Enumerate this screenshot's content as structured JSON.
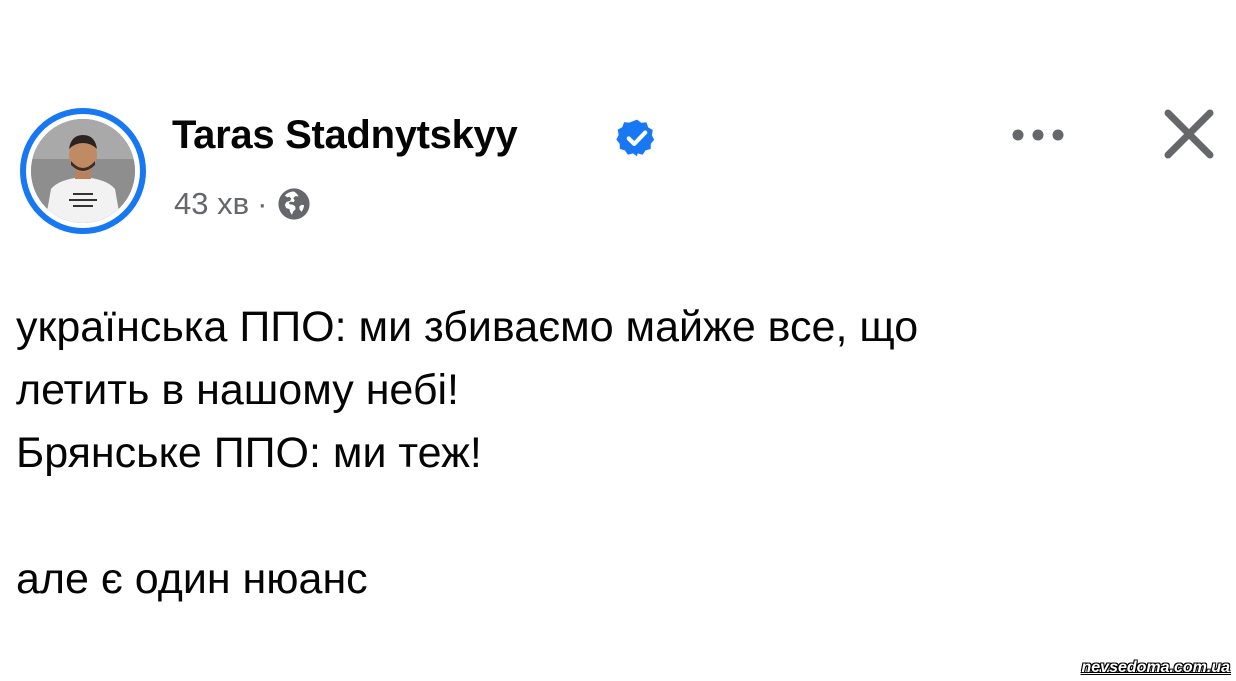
{
  "post": {
    "author": {
      "name": "Taras Stadnytskyy",
      "verified": true
    },
    "time": "43 хв",
    "separator": "·",
    "audience_icon": "globe-icon",
    "body_lines": [
      "українська ППО: ми збиваємо майже все, що",
      "летить в нашому небі!",
      "Брянське ППО: ми теж!",
      "",
      "але є один нюанс"
    ]
  },
  "actions": {
    "more_icon": "more-dots-icon",
    "close_icon": "close-icon"
  },
  "watermark": "nevsedoma.com.ua",
  "colors": {
    "accent": "#1877f2",
    "text": "#050505",
    "secondary_text": "#65676b",
    "icon": "#65676b",
    "background": "#ffffff"
  }
}
